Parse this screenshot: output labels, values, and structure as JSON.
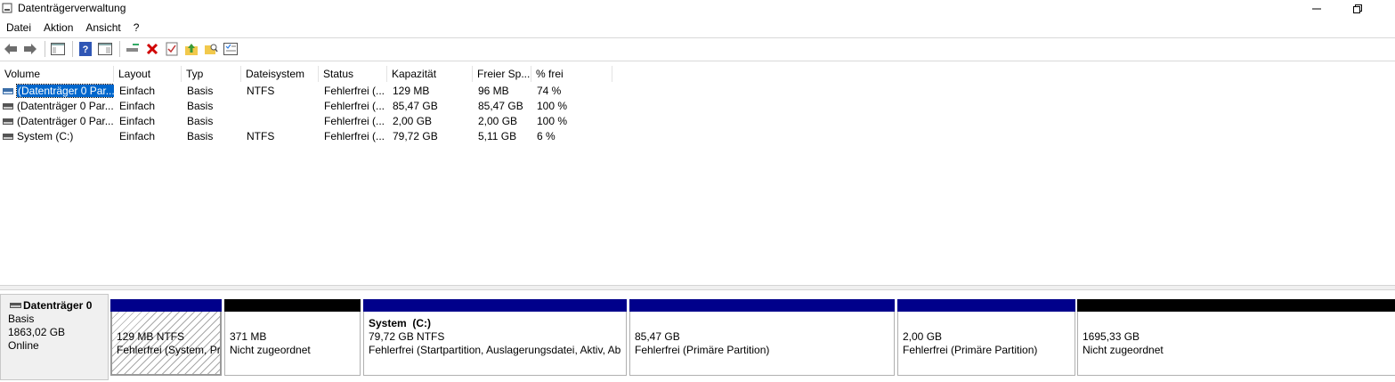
{
  "window": {
    "title": "Datenträgerverwaltung"
  },
  "menu": [
    "Datei",
    "Aktion",
    "Ansicht",
    "?"
  ],
  "toolbar": {
    "icons": [
      "back-arrow-icon",
      "forward-arrow-icon",
      "show-hide-console-tree-icon",
      "help-icon",
      "properties-pane-icon",
      "connect-disk-icon",
      "delete-icon",
      "check-properties-icon",
      "open-folder-up-icon",
      "search-folder-icon",
      "settings-list-icon"
    ]
  },
  "volume_list": {
    "columns": [
      "Volume",
      "Layout",
      "Typ",
      "Dateisystem",
      "Status",
      "Kapazität",
      "Freier Sp...",
      "% frei"
    ],
    "rows": [
      {
        "volume": "(Datenträger 0 Par...",
        "layout": "Einfach",
        "typ": "Basis",
        "dateisystem": "NTFS",
        "status": "Fehlerfrei (...",
        "kapazitaet": "129 MB",
        "frei": "96 MB",
        "prozent": "74 %",
        "selected": true
      },
      {
        "volume": "(Datenträger 0 Par...",
        "layout": "Einfach",
        "typ": "Basis",
        "dateisystem": "",
        "status": "Fehlerfrei (...",
        "kapazitaet": "85,47 GB",
        "frei": "85,47 GB",
        "prozent": "100 %",
        "selected": false
      },
      {
        "volume": "(Datenträger 0 Par...",
        "layout": "Einfach",
        "typ": "Basis",
        "dateisystem": "",
        "status": "Fehlerfrei (...",
        "kapazitaet": "2,00 GB",
        "frei": "2,00 GB",
        "prozent": "100 %",
        "selected": false
      },
      {
        "volume": "System (C:)",
        "layout": "Einfach",
        "typ": "Basis",
        "dateisystem": "NTFS",
        "status": "Fehlerfrei (...",
        "kapazitaet": "79,72 GB",
        "frei": "5,11 GB",
        "prozent": "6 %",
        "selected": false
      }
    ]
  },
  "disk": {
    "name": "Datenträger 0",
    "type": "Basis",
    "size": "1863,02 GB",
    "state": "Online",
    "partitions": [
      {
        "title": "",
        "line1": "129 MB NTFS",
        "line2": "Fehlerfrei (System, Pr",
        "kind": "primary",
        "hatched": true
      },
      {
        "title": "",
        "line1": "371 MB",
        "line2": "Nicht zugeordnet",
        "kind": "unallocated",
        "hatched": false
      },
      {
        "title": "System  (C:)",
        "line1": "79,72 GB NTFS",
        "line2": "Fehlerfrei (Startpartition, Auslagerungsdatei, Aktiv, Ab",
        "kind": "primary",
        "hatched": false
      },
      {
        "title": "",
        "line1": "85,47 GB",
        "line2": "Fehlerfrei (Primäre Partition)",
        "kind": "primary",
        "hatched": false
      },
      {
        "title": "",
        "line1": "2,00 GB",
        "line2": "Fehlerfrei (Primäre Partition)",
        "kind": "primary",
        "hatched": false
      },
      {
        "title": "",
        "line1": "1695,33 GB",
        "line2": "Nicht zugeordnet",
        "kind": "unallocated",
        "hatched": false
      }
    ]
  },
  "colors": {
    "primary_partition": "#00008b",
    "unallocated": "#000000",
    "selection": "#0066cc"
  }
}
